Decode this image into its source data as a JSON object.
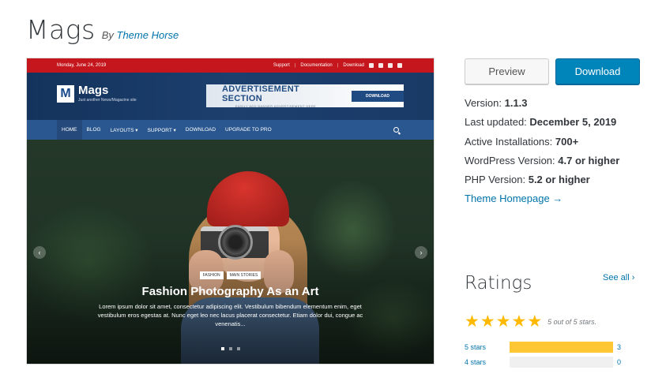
{
  "theme": {
    "name": "Mags",
    "by_prefix": "By",
    "author": "Theme Horse"
  },
  "screenshot": {
    "topbar": {
      "date": "Monday, June 24, 2019",
      "links": [
        "Support",
        "Documentation",
        "Download"
      ]
    },
    "logo": {
      "letter": "M",
      "name": "Mags",
      "tagline": "Just another News/Magazine site"
    },
    "ad": {
      "title": "ADVERTISEMENT SECTION",
      "subtitle": "EASILY ADD BANNER ADVERTISEMENT HERE",
      "button": "DOWNLOAD"
    },
    "nav": [
      "HOME",
      "BLOG",
      "LAYOUTS ▾",
      "SUPPORT ▾",
      "DOWNLOAD",
      "UPGRADE TO PRO"
    ],
    "hero": {
      "categories": [
        "FASHION",
        "MAIN STORIES"
      ],
      "title": "Fashion Photography As an Art",
      "excerpt": "Lorem ipsum dolor sit amet, consectetur adipiscing elit. Vestibulum bibendum elementum enim, eget vestibulum eros egestas at. Nunc eget leo nec lacus placerat consectetur. Etiam dolor dui, congue ac venenatis...",
      "arrow_left": "‹",
      "arrow_right": "›"
    }
  },
  "actions": {
    "preview": "Preview",
    "download": "Download"
  },
  "meta": {
    "version_label": "Version:",
    "version": "1.1.3",
    "updated_label": "Last updated:",
    "updated": "December 5, 2019",
    "installs_label": "Active Installations:",
    "installs": "700+",
    "wp_label": "WordPress Version:",
    "wp": "4.7 or higher",
    "php_label": "PHP Version:",
    "php": "5.2 or higher",
    "homepage": "Theme Homepage →"
  },
  "ratings": {
    "title": "Ratings",
    "see_all": "See all ›",
    "summary": "5 out of 5 stars.",
    "stars": 5,
    "rows": [
      {
        "label": "5 stars",
        "count": "3",
        "fraction": 1.0
      },
      {
        "label": "4 stars",
        "count": "0",
        "fraction": 0.0
      }
    ]
  },
  "colors": {
    "link": "#0073aa",
    "download_btn": "#0085ba",
    "star": "#ffb900",
    "bar_fill": "#ffc733",
    "topbar": "#c4161c"
  }
}
